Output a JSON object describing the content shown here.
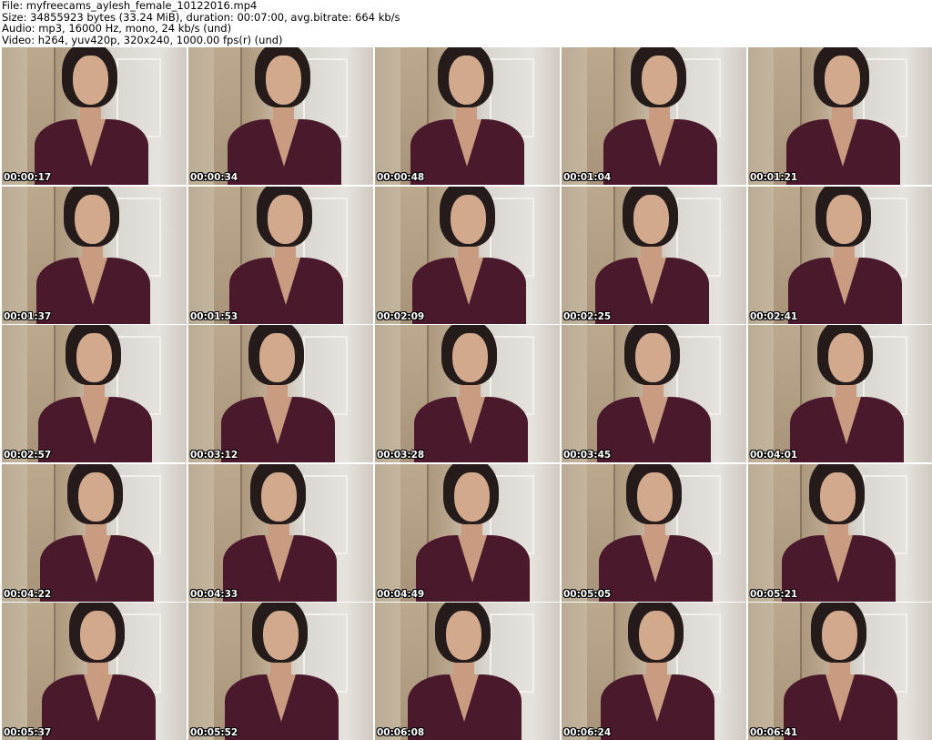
{
  "header": {
    "file": "File: myfreecams_aylesh_female_10122016.mp4",
    "size": "Size: 34855923 bytes (33.24 MiB), duration: 00:07:00, avg.bitrate: 664 kb/s",
    "audio": "Audio: mp3, 16000 Hz, mono, 24 kb/s (und)",
    "video": "Video: h264, yuv420p, 320x240, 1000.00 fps(r) (und)"
  },
  "thumbnails": [
    "00:00:17",
    "00:00:34",
    "00:00:48",
    "00:01:04",
    "00:01:21",
    "00:01:37",
    "00:01:53",
    "00:02:09",
    "00:02:25",
    "00:02:41",
    "00:02:57",
    "00:03:12",
    "00:03:28",
    "00:03:45",
    "00:04:01",
    "00:04:22",
    "00:04:33",
    "00:04:49",
    "00:05:05",
    "00:05:21",
    "00:05:37",
    "00:05:52",
    "00:06:08",
    "00:06:24",
    "00:06:41"
  ]
}
